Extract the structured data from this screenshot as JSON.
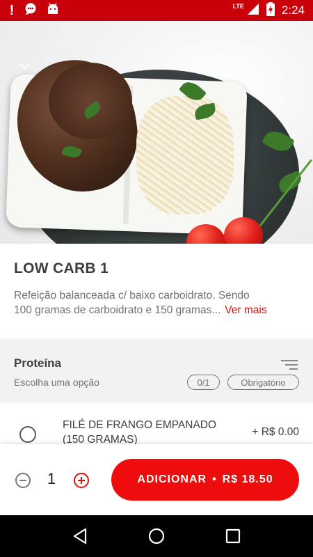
{
  "status_bar": {
    "time": "2:24",
    "network": "LTE",
    "icons": [
      "alert-icon",
      "chat-icon",
      "android-icon",
      "signal-icon",
      "battery-charging-icon"
    ]
  },
  "product": {
    "title": "LOW CARB 1",
    "description_line1": "Refeição balanceada c/ baixo carboidrato. Sendo",
    "description_line2": "100 gramas de carboidrato e 150 gramas...",
    "see_more": "Ver mais"
  },
  "section": {
    "title": "Proteína",
    "subtitle": "Escolha uma opção",
    "count_badge": "0/1",
    "required_badge": "Obrigatório"
  },
  "options": [
    {
      "name": "FILÉ DE FRANGO EMPANADO (150 GRAMAS)",
      "price": "+ R$ 0.00",
      "selected": false
    }
  ],
  "cart": {
    "quantity": "1",
    "add_label": "ADICIONAR",
    "separator": "•",
    "total": "R$ 18.50"
  },
  "colors": {
    "status_bar": "#c8000a",
    "accent": "#ee0c0c",
    "link": "#e0100b",
    "section_bg": "#f2f2f2"
  },
  "nav": [
    "back-icon",
    "home-icon",
    "recents-icon"
  ]
}
